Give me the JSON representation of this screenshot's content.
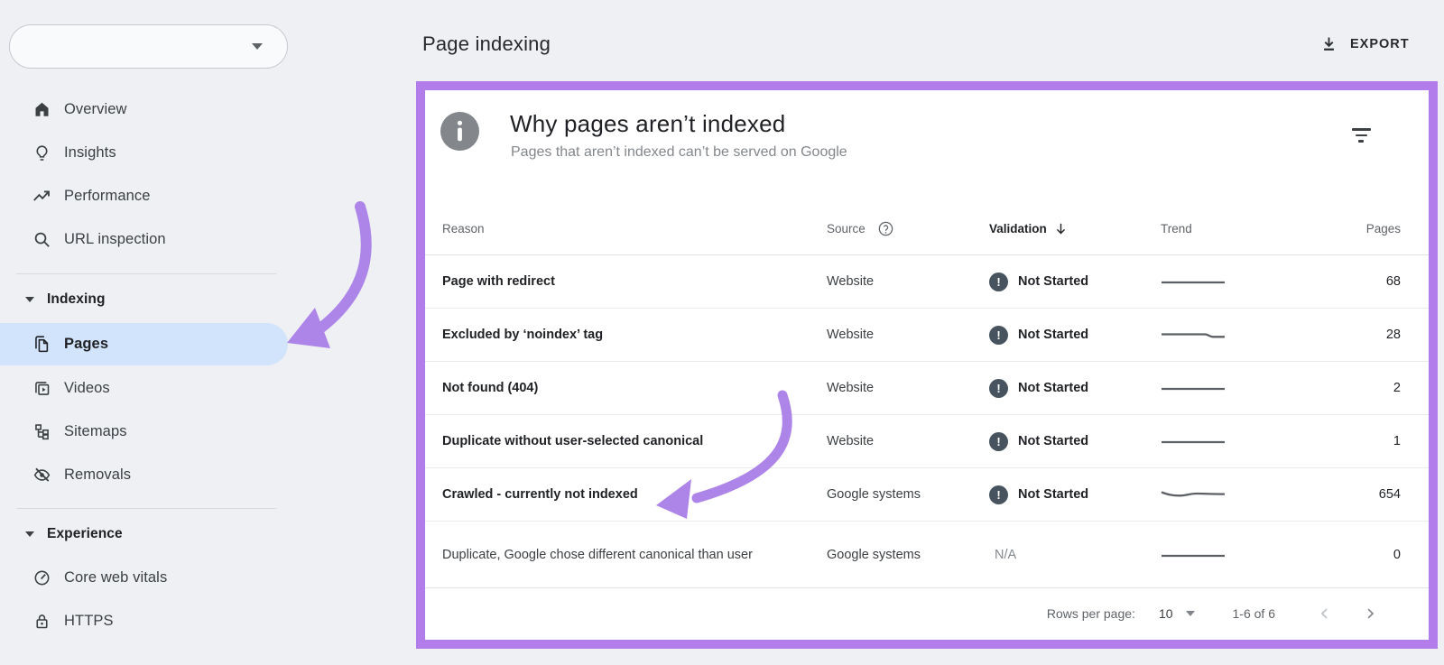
{
  "colors": {
    "annotation_purple": "#b27deb",
    "arrow_purple": "#ad85e8",
    "selected_item_blue": "#d2e3fc",
    "badge_slate": "#47545f",
    "background": "#eef0f4"
  },
  "sidebar": {
    "property_selector": {
      "value": ""
    },
    "sections": [
      {
        "items": [
          {
            "label": "Overview"
          },
          {
            "label": "Insights"
          },
          {
            "label": "Performance"
          },
          {
            "label": "URL inspection"
          }
        ]
      },
      {
        "header": "Indexing",
        "items": [
          {
            "label": "Pages",
            "selected": true
          },
          {
            "label": "Videos"
          },
          {
            "label": "Sitemaps"
          },
          {
            "label": "Removals"
          }
        ]
      },
      {
        "header": "Experience",
        "items": [
          {
            "label": "Core web vitals"
          },
          {
            "label": "HTTPS"
          }
        ]
      }
    ]
  },
  "header": {
    "title": "Page indexing",
    "export_label": "EXPORT"
  },
  "card": {
    "title": "Why pages aren’t indexed",
    "subtitle": "Pages that aren’t indexed can’t be served on Google",
    "columns": {
      "reason": "Reason",
      "source": "Source",
      "validation": "Validation",
      "trend": "Trend",
      "pages": "Pages"
    },
    "rows": [
      {
        "reason": "Page with redirect",
        "source": "Website",
        "validation": "Not Started",
        "trend": "flat",
        "pages": "68"
      },
      {
        "reason": "Excluded by ‘noindex’ tag",
        "source": "Website",
        "validation": "Not Started",
        "trend": "dip-end",
        "pages": "28"
      },
      {
        "reason": "Not found (404)",
        "source": "Website",
        "validation": "Not Started",
        "trend": "flat",
        "pages": "2"
      },
      {
        "reason": "Duplicate without user-selected canonical",
        "source": "Website",
        "validation": "Not Started",
        "trend": "flat",
        "pages": "1"
      },
      {
        "reason": "Crawled - currently not indexed",
        "source": "Google systems",
        "validation": "Not Started",
        "trend": "wavy",
        "pages": "654"
      },
      {
        "reason": "Duplicate, Google chose different canonical than user",
        "source": "Google systems",
        "validation": "N/A",
        "trend": "flat",
        "pages": "0"
      }
    ],
    "footer": {
      "rows_per_page_label": "Rows per page:",
      "rows_per_page_value": "10",
      "range": "1-6 of 6"
    }
  }
}
